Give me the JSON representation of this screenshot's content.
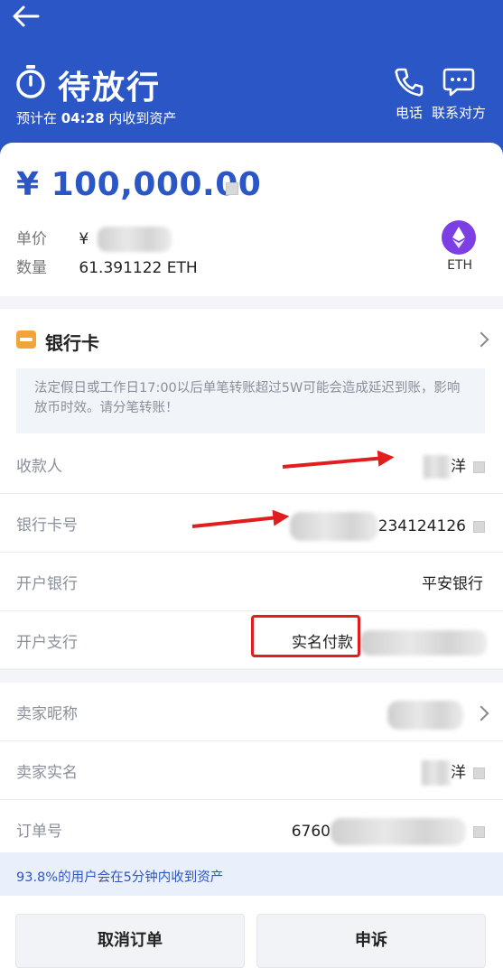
{
  "header": {
    "title": "待放行",
    "subtitle_prefix": "预计在",
    "countdown": "04:28",
    "subtitle_suffix": "内收到资产",
    "phone_label": "电话",
    "contact_label": "联系对方",
    "bg_color": "#2b57c6"
  },
  "order": {
    "amount": "¥ 100,000.00",
    "price_label": "单价",
    "price_prefix": "¥",
    "qty_label": "数量",
    "qty_value": "61.391122 ETH",
    "coin": "ETH"
  },
  "bank": {
    "title": "银行卡",
    "notice": "法定假日或工作日17:00以后单笔转账超过5W可能会造成延迟到账，影响放币时效。请分笔转账！",
    "rows": [
      {
        "label": "收款人",
        "value": "洋"
      },
      {
        "label": "银行卡号",
        "value": "234124126"
      },
      {
        "label": "开户银行",
        "value": "平安银行"
      },
      {
        "label": "开户支行",
        "value": "实名付款"
      }
    ]
  },
  "seller": {
    "rows": [
      {
        "label": "卖家昵称",
        "value": ""
      },
      {
        "label": "卖家实名",
        "value": "洋"
      },
      {
        "label": "订单号",
        "value": "6760"
      }
    ]
  },
  "footer_note": "93.8%的用户会在5分钟内收到资产",
  "buttons": {
    "cancel": "取消订单",
    "appeal": "申诉"
  },
  "icons": [
    "back-arrow-icon",
    "stopwatch-icon",
    "phone-icon",
    "chat-icon",
    "ethereum-icon",
    "bank-card-icon",
    "chevron-right-icon",
    "copy-icon"
  ],
  "colors": {
    "accent": "#2b57c6",
    "eth": "#7b3fe4",
    "bank_icon": "#f0a43a",
    "annotation": "#e11d1d"
  }
}
